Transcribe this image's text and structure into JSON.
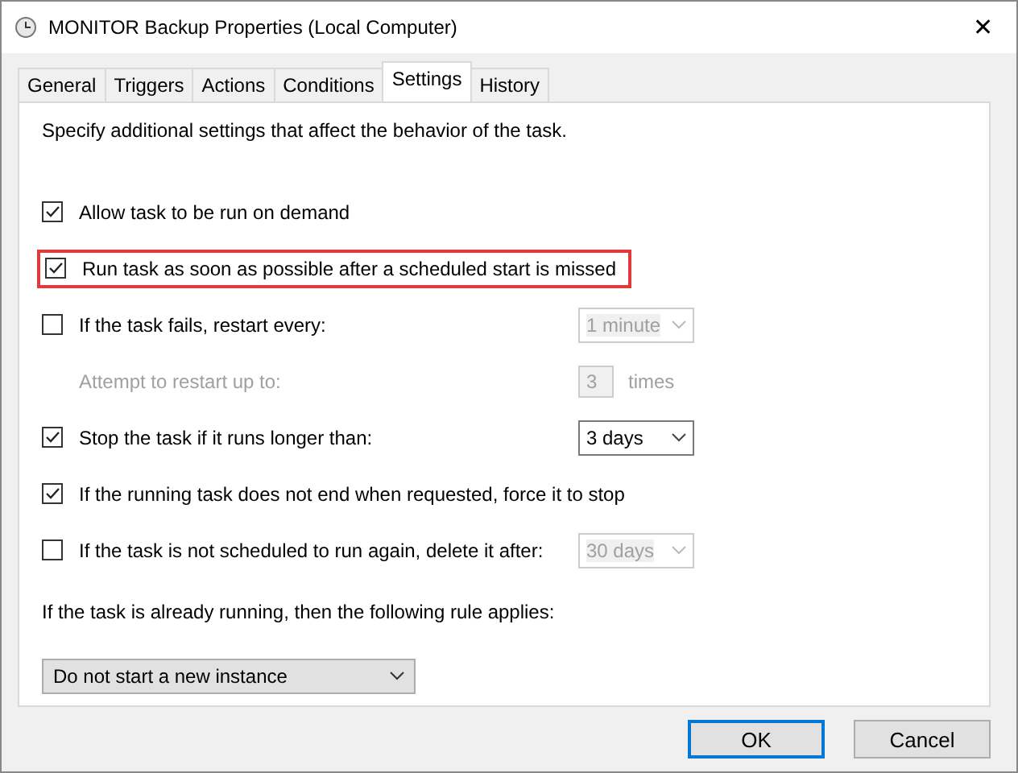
{
  "window": {
    "title": "MONITOR Backup Properties (Local Computer)",
    "close": "✕"
  },
  "tabs": [
    {
      "label": "General",
      "selected": false
    },
    {
      "label": "Triggers",
      "selected": false
    },
    {
      "label": "Actions",
      "selected": false
    },
    {
      "label": "Conditions",
      "selected": false
    },
    {
      "label": "Settings",
      "selected": true
    },
    {
      "label": "History",
      "selected": false
    }
  ],
  "description": "Specify additional settings that affect the behavior of the task.",
  "rows": [
    {
      "kind": "checkbox",
      "label": "Allow task to be run on demand",
      "checked": true,
      "highlighted": false
    },
    {
      "kind": "checkbox",
      "label": "Run task as soon as possible after a scheduled start is missed",
      "checked": true,
      "highlighted": true
    },
    {
      "kind": "checkbox",
      "label": "If the task fails, restart every:",
      "checked": false,
      "highlighted": false,
      "control": {
        "kind": "dropdown",
        "value": "1 minute",
        "disabled": true
      }
    },
    {
      "kind": "text",
      "label": "Attempt to restart up to:",
      "disabled": true,
      "control": {
        "kind": "spinner",
        "value": "3",
        "suffix": "times",
        "disabled": true
      }
    },
    {
      "kind": "checkbox",
      "label": "Stop the task if it runs longer than:",
      "checked": true,
      "highlighted": false,
      "control": {
        "kind": "dropdown",
        "value": "3 days",
        "disabled": false
      }
    },
    {
      "kind": "checkbox",
      "label": "If the running task does not end when requested, force it to stop",
      "checked": true,
      "highlighted": false
    },
    {
      "kind": "checkbox",
      "label": "If the task is not scheduled to run again, delete it after:",
      "checked": false,
      "highlighted": false,
      "control": {
        "kind": "dropdown",
        "value": "30 days",
        "disabled": true
      }
    }
  ],
  "rule_label": "If the task is already running, then the following rule applies:",
  "rule_dropdown": {
    "value": "Do not start a new instance"
  },
  "buttons": [
    {
      "label": "OK",
      "default": true
    },
    {
      "label": "Cancel",
      "default": false
    }
  ]
}
